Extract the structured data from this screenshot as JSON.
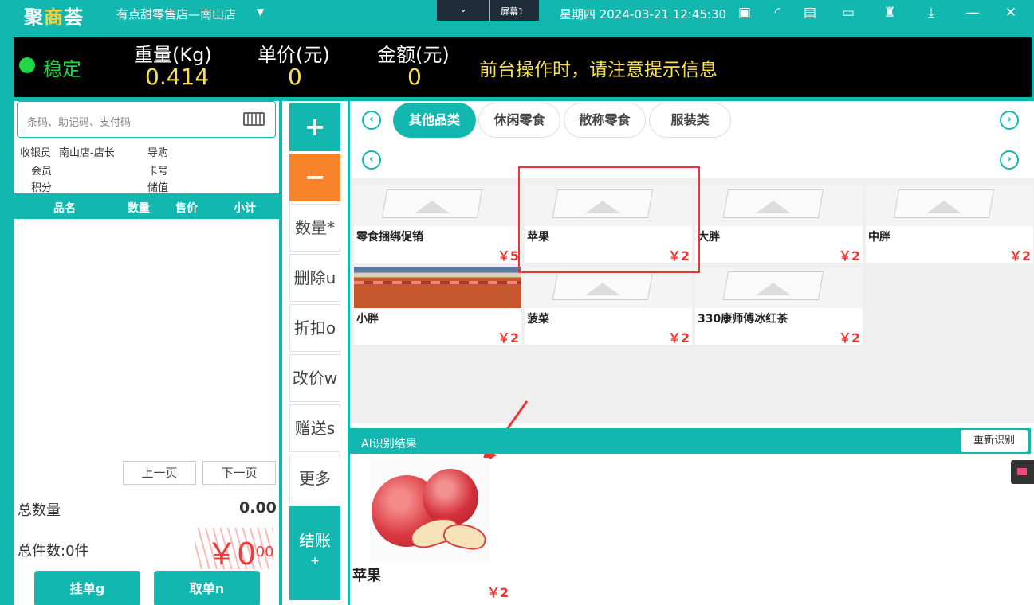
{
  "topbar": {
    "logo_a": "聚",
    "logo_b": "商",
    "logo_c": "荟",
    "store_name": "有点甜零售店—南山店",
    "screen_label": "屏幕1",
    "datetime": "星期四 2024-03-21 12:45:30",
    "icons": [
      "cash-drawer-icon",
      "wifi-signal-icon",
      "printer-icon",
      "message-icon",
      "tshirt-icon",
      "download-icon",
      "minimize-icon",
      "close-icon"
    ]
  },
  "scale": {
    "status": "稳定",
    "weight_label": "重量(Kg)",
    "weight_value": "0.414",
    "unit_price_label": "单价(元)",
    "unit_price_value": "0",
    "amount_label": "金额(元)",
    "amount_value": "0",
    "notice": "前台操作时，请注意提示信息"
  },
  "left": {
    "search_placeholder": "条码、助记码、支付码",
    "cashier_label": "收银员",
    "cashier_value": "南山店-店长",
    "guide_label": "导购",
    "member_label": "会员",
    "card_label": "卡号",
    "points_label": "积分",
    "stored_label": "储值",
    "columns": [
      "品名",
      "数量",
      "售价",
      "小计"
    ],
    "prev_page": "上一页",
    "next_page": "下一页",
    "total_qty_label": "总数量",
    "total_qty_value": "0.00",
    "total_items_label": "总件数:0件",
    "total_amount_int": "￥0",
    "total_amount_dec": ".00",
    "hold_button": "挂单g",
    "retrieve_button": "取单n"
  },
  "middle": {
    "plus": "+",
    "minus": "−",
    "qty": "数量*",
    "delete": "删除u",
    "discount": "折扣o",
    "change_price": "改价w",
    "gift": "赠送s",
    "more": "更多",
    "checkout": "结账",
    "checkout_sub": "+"
  },
  "right": {
    "categories": [
      "其他品类",
      "休闲零食",
      "散称零食",
      "服装类"
    ],
    "products": [
      {
        "name": "零食捆绑促销",
        "price": "￥5"
      },
      {
        "name": "苹果",
        "price": "￥2"
      },
      {
        "name": "大胖",
        "price": "￥2"
      },
      {
        "name": "中胖",
        "price": "￥2"
      },
      {
        "name": "小胖",
        "price": "￥2"
      },
      {
        "name": "菠菜",
        "price": "￥2"
      },
      {
        "name": "330康师傅冰红茶",
        "price": "￥2"
      }
    ],
    "ai_title": "AI识别结果",
    "reidentify": "重新识别",
    "ai_result_name": "苹果",
    "ai_result_price": "￥2"
  }
}
